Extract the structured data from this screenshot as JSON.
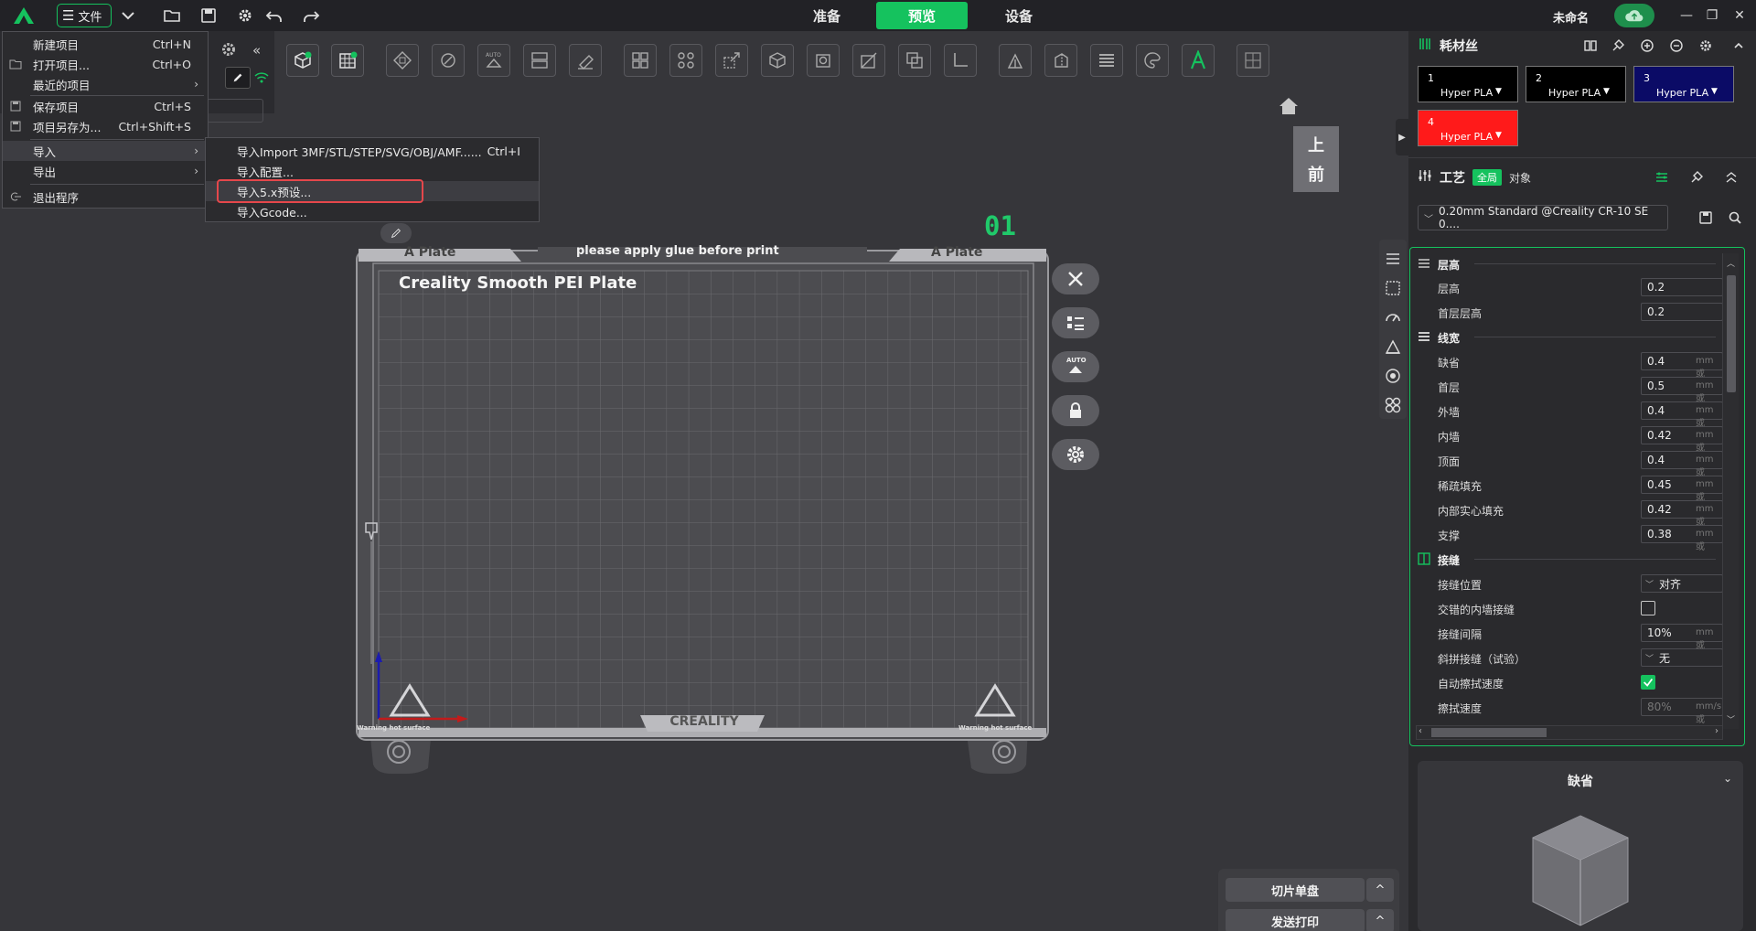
{
  "topbar": {
    "file_label": "文件",
    "tabs": [
      "准备",
      "预览",
      "设备"
    ],
    "active_tab": "预览",
    "project_title": "未命名",
    "accent": "#15c25e"
  },
  "file_menu": {
    "items": [
      {
        "label": "新建项目",
        "shortcut": "Ctrl+N"
      },
      {
        "label": "打开项目...",
        "shortcut": "Ctrl+O"
      },
      {
        "label": "最近的项目",
        "shortcut": ""
      },
      {
        "label": "保存项目",
        "shortcut": "Ctrl+S"
      },
      {
        "label": "项目另存为...",
        "shortcut": "Ctrl+Shift+S"
      },
      {
        "label": "导入",
        "shortcut": ""
      },
      {
        "label": "导出",
        "shortcut": ""
      },
      {
        "label": "退出程序",
        "shortcut": ""
      }
    ]
  },
  "import_submenu": {
    "items": [
      {
        "label": "导入Import 3MF/STL/STEP/SVG/OBJ/AMF......",
        "shortcut": "Ctrl+I"
      },
      {
        "label": "导入配置...",
        "shortcut": ""
      },
      {
        "label": "导入5.x预设...",
        "shortcut": ""
      },
      {
        "label": "导入Gcode...",
        "shortcut": ""
      }
    ],
    "highlighted": "导入5.x预设..."
  },
  "viewport": {
    "plate_number": "01",
    "view_cube_top": "上",
    "view_cube_front": "前",
    "plate_brand": "Creality Smooth PEI Plate",
    "plate_left_tab": "A Plate",
    "plate_right_tab": "A Plate",
    "plate_top_note": "please apply glue before print",
    "plate_bottom_brand": "CREALITY",
    "warning_text": "Warning hot surface"
  },
  "actions": {
    "slice_plate": "切片单盘",
    "send_print": "发送打印",
    "arrow": "^"
  },
  "filament_panel": {
    "title": "耗材丝",
    "filaments": [
      {
        "num": "1",
        "name": "Hyper PLA",
        "color": "#000000"
      },
      {
        "num": "2",
        "name": "Hyper PLA",
        "color": "#000000"
      },
      {
        "num": "3",
        "name": "Hyper PLA",
        "color": "#0b0b66"
      },
      {
        "num": "4",
        "name": "Hyper PLA",
        "color": "#ff1a1a"
      }
    ]
  },
  "process_panel": {
    "title": "工艺",
    "scope_global": "全局",
    "scope_object": "对象",
    "preset": "0.20mm Standard @Creality CR-10 SE 0...."
  },
  "settings": {
    "groups": [
      {
        "label": "层高",
        "rows": [
          {
            "label": "层高",
            "value": "0.2",
            "unit": ""
          },
          {
            "label": "首层层高",
            "value": "0.2",
            "unit": ""
          }
        ]
      },
      {
        "label": "线宽",
        "rows": [
          {
            "label": "缺省",
            "value": "0.4",
            "unit": "mm 或"
          },
          {
            "label": "首层",
            "value": "0.5",
            "unit": "mm 或"
          },
          {
            "label": "外墙",
            "value": "0.4",
            "unit": "mm 或"
          },
          {
            "label": "内墙",
            "value": "0.42",
            "unit": "mm 或"
          },
          {
            "label": "顶面",
            "value": "0.4",
            "unit": "mm 或"
          },
          {
            "label": "稀疏填充",
            "value": "0.45",
            "unit": "mm 或"
          },
          {
            "label": "内部实心填充",
            "value": "0.42",
            "unit": "mm 或"
          },
          {
            "label": "支撑",
            "value": "0.38",
            "unit": "mm 或"
          }
        ]
      },
      {
        "label": "接缝"
      }
    ],
    "seam": {
      "position_label": "接缝位置",
      "position_value": "对齐",
      "staggered_label": "交错的内墙接缝",
      "gap_label": "接缝间隔",
      "gap_value": "10%",
      "gap_unit": "mm 或",
      "scarf_label": "斜拼接缝（试验）",
      "scarf_value": "无",
      "wipe_auto_label": "自动擦拭速度",
      "wipe_speed_label": "擦拭速度",
      "wipe_speed_value": "80%",
      "wipe_speed_unit": "mm/s 或"
    }
  },
  "preview": {
    "title": "缺省"
  }
}
